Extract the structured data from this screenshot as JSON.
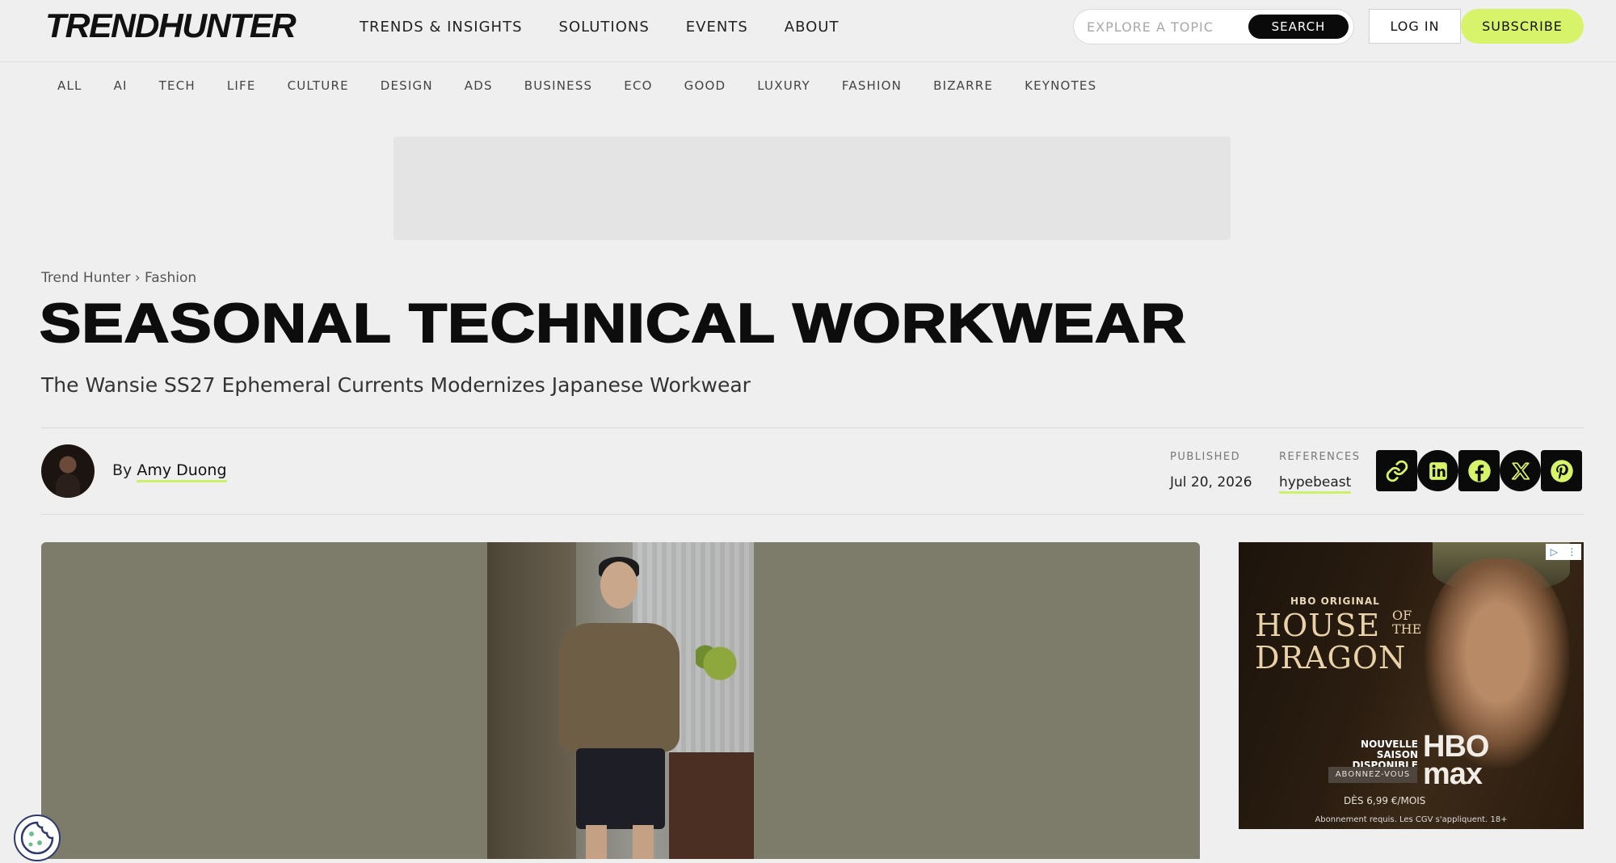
{
  "header": {
    "logo": "TRENDHUNTER",
    "nav": [
      "TRENDS & INSIGHTS",
      "SOLUTIONS",
      "EVENTS",
      "ABOUT"
    ],
    "search_placeholder": "EXPLORE A TOPIC",
    "search_button": "SEARCH",
    "login": "LOG IN",
    "subscribe": "SUBSCRIBE"
  },
  "categories": [
    "ALL",
    "AI",
    "TECH",
    "LIFE",
    "CULTURE",
    "DESIGN",
    "ADS",
    "BUSINESS",
    "ECO",
    "GOOD",
    "LUXURY",
    "FASHION",
    "BIZARRE",
    "KEYNOTES"
  ],
  "article": {
    "breadcrumb": {
      "home": "Trend Hunter",
      "separator": "›",
      "section": "Fashion"
    },
    "title": "SEASONAL TECHNICAL WORKWEAR",
    "subtitle": "The Wansie SS27 Ephemeral Currents Modernizes Japanese Workwear",
    "byline_prefix": "By",
    "author": "Amy Duong",
    "published_label": "PUBLISHED",
    "published_date": "Jul 20, 2026",
    "references_label": "REFERENCES",
    "reference": "hypebeast",
    "share_icons": [
      "link-icon",
      "linkedin-icon",
      "facebook-icon",
      "x-icon",
      "pinterest-icon"
    ]
  },
  "side_ad": {
    "brand_original": "HBO ORIGINAL",
    "title_line1": "HOUSE",
    "title_ofthe": "OF THE",
    "title_line2": "DRAGON",
    "nouvelle": "NOUVELLE SAISON DISPONIBLE",
    "cta": "ABONNEZ-VOUS",
    "logo_line1": "HBO",
    "logo_line2": "max",
    "price": "DÈS 6,99 €/MOIS",
    "fine_print": "Abonnement requis. Les CGV s'appliquent. 18+"
  },
  "colors": {
    "accent": "#d7f36a",
    "background": "#efefef",
    "dark": "#0a0a0a"
  }
}
